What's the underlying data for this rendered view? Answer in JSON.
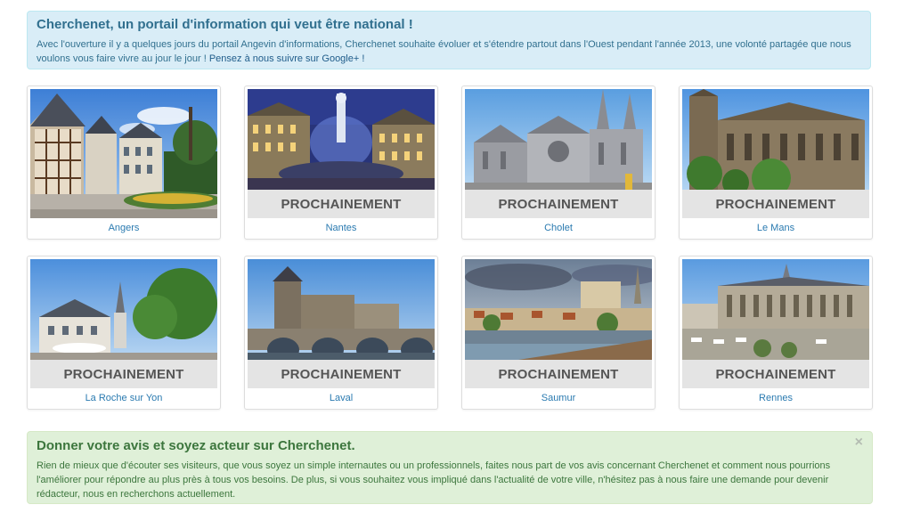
{
  "intro": {
    "title": "Cherchenet, un portail d'information qui veut être national !",
    "text": "Avec l'ouverture il y a quelques jours du portail Angevin d'informations, Cherchenet souhaite évoluer et s'étendre partout dans l'Ouest pendant l'année 2013, une volonté partagée que nous voulons vous faire vivre au jour le jour ! ",
    "link_label": "Pensez à nous suivre sur Google+ !"
  },
  "cities": [
    {
      "name": "Angers",
      "soon": ""
    },
    {
      "name": "Nantes",
      "soon": "PROCHAINEMENT"
    },
    {
      "name": "Cholet",
      "soon": "PROCHAINEMENT"
    },
    {
      "name": "Le Mans",
      "soon": "PROCHAINEMENT"
    },
    {
      "name": "La Roche sur Yon",
      "soon": "PROCHAINEMENT"
    },
    {
      "name": "Laval",
      "soon": "PROCHAINEMENT"
    },
    {
      "name": "Saumur",
      "soon": "PROCHAINEMENT"
    },
    {
      "name": "Rennes",
      "soon": "PROCHAINEMENT"
    }
  ],
  "feedback": {
    "title": "Donner votre avis et soyez acteur sur Cherchenet.",
    "text": "Rien de mieux que d'écouter ses visiteurs, que vous soyez un simple internautes ou un professionnels, faites nous part de vos avis concernant Cherchenet et comment nous pourrions l'améliorer pour répondre au plus près à tous vos besoins. De plus, si vous souhaitez vous impliqué dans l'actualité de votre ville, n'hésitez pas à nous faire une demande pour devenir rédacteur, nous en recherchons actuellement.",
    "close_label": "×"
  },
  "colors": {
    "info_bg": "#d9edf7",
    "success_bg": "#dff0d8",
    "link": "#2a7ab0"
  }
}
